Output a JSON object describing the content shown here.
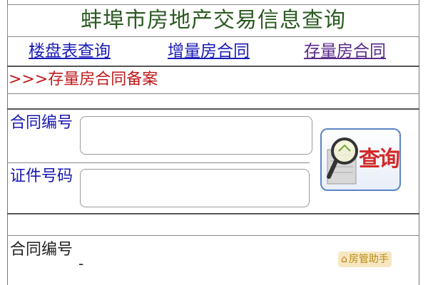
{
  "header": {
    "title": "蚌埠市房地产交易信息查询"
  },
  "nav": {
    "items": [
      {
        "label": "楼盘表查询"
      },
      {
        "label": "增量房合同"
      },
      {
        "label": "存量房合同"
      }
    ]
  },
  "breadcrumb": {
    "text": ">>>存量房合同备案"
  },
  "form": {
    "contract_no_label": "合同编号",
    "id_no_label": "证件号码",
    "contract_no_value": "",
    "id_no_value": "",
    "query_button_label": "查询"
  },
  "result": {
    "contract_no_label": "合同编号",
    "contract_no_value": "-"
  },
  "helper": {
    "label": "房管助手"
  },
  "colors": {
    "title": "#2b5a22",
    "nav_link": "#1b1bb8",
    "nav_link_visited": "#5a2a88",
    "breadcrumb": "#c0191b",
    "label": "#1818b0",
    "button_text": "#d22a2a"
  },
  "icons": {
    "query_button": "magnifier-icon",
    "helper": "house-icon"
  }
}
